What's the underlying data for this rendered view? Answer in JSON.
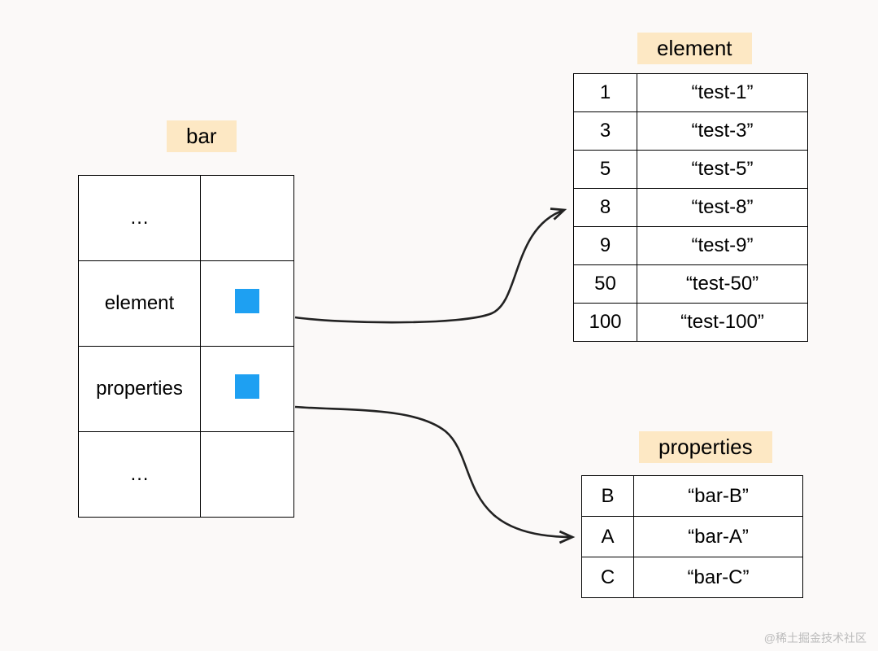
{
  "bar": {
    "title": "bar",
    "rows": [
      {
        "key": "…",
        "pointer": false
      },
      {
        "key": "element",
        "pointer": true
      },
      {
        "key": "properties",
        "pointer": true
      },
      {
        "key": "…",
        "pointer": false
      }
    ]
  },
  "element": {
    "title": "element",
    "rows": [
      {
        "key": "1",
        "value": "“test-1”"
      },
      {
        "key": "3",
        "value": "“test-3”"
      },
      {
        "key": "5",
        "value": "“test-5”"
      },
      {
        "key": "8",
        "value": "“test-8”"
      },
      {
        "key": "9",
        "value": "“test-9”"
      },
      {
        "key": "50",
        "value": "“test-50”"
      },
      {
        "key": "100",
        "value": "“test-100”"
      }
    ]
  },
  "properties": {
    "title": "properties",
    "rows": [
      {
        "key": "B",
        "value": "“bar-B”"
      },
      {
        "key": "A",
        "value": "“bar-A”"
      },
      {
        "key": "C",
        "value": "“bar-C”"
      }
    ]
  },
  "watermark": "@稀土掘金技术社区"
}
